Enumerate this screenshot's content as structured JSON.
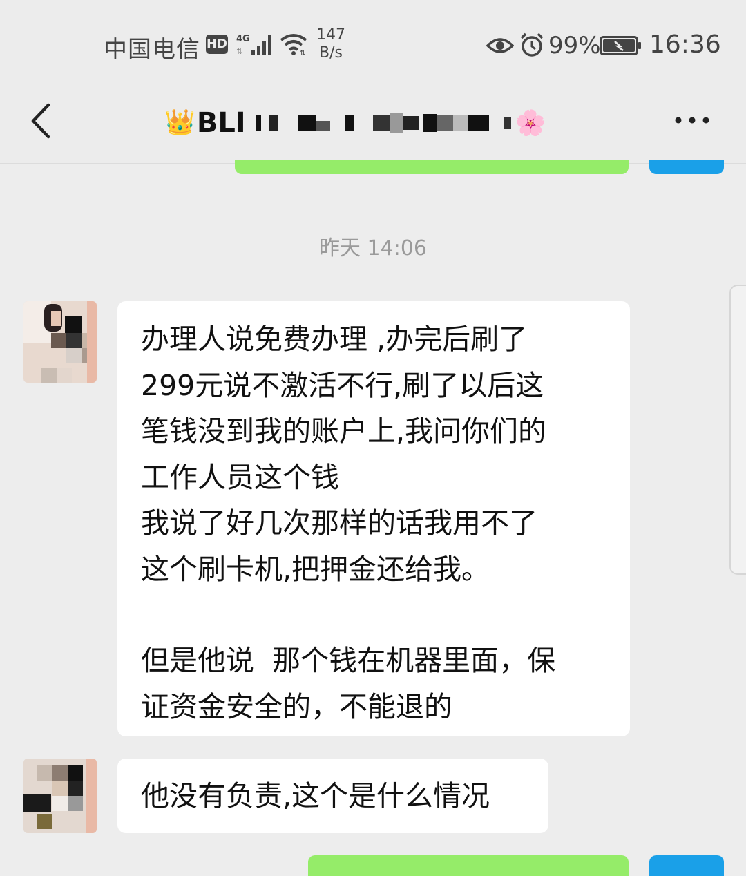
{
  "status_bar": {
    "carrier": "中国电信",
    "hd": "HD",
    "network": "4G",
    "speed_value": "147",
    "speed_unit": "B/s",
    "battery_percent": "99%",
    "time": "16:36",
    "icons": [
      "hd-icon",
      "signal-icon",
      "wifi-icon",
      "eye-icon",
      "alarm-icon",
      "battery-icon"
    ]
  },
  "header": {
    "title_emoji": "👑",
    "title_visible": "BLI",
    "title_suffix_emoji": "🌸",
    "back_icon": "chevron-left-icon",
    "more_icon": "more-dots-icon"
  },
  "chat": {
    "timestamp": "昨天 14:06",
    "messages": [
      {
        "sender": "other",
        "lines": [
          "办理人说免费办理 ,办完后刷了",
          "299元说不激活不行,刷了以后这",
          "笔钱没到我的账户上,我问你们的",
          "工作人员这个钱",
          "我说了好几次那样的话我用不了",
          "这个刷卡机,把押金还给我。",
          "",
          "但是他说  那个钱在机器里面，保",
          "证资金安全的，不能退的"
        ]
      },
      {
        "sender": "other",
        "lines": [
          "他没有负责,这个是什么情况"
        ]
      }
    ]
  },
  "colors": {
    "background": "#ededed",
    "bubble_other": "#ffffff",
    "bubble_self": "#95ec69",
    "accent_blue": "#1aa0e8"
  }
}
